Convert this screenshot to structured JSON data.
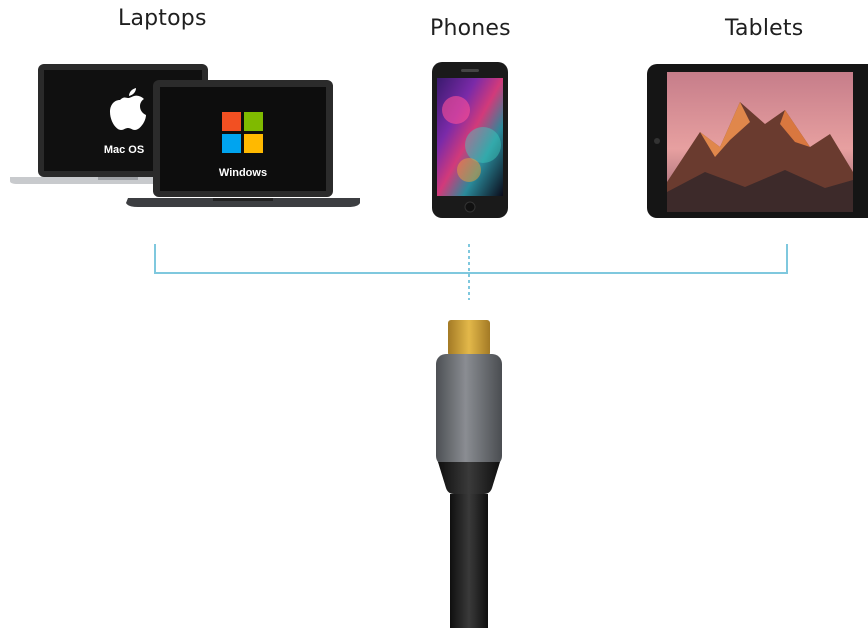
{
  "labels": {
    "laptops": "Laptops",
    "phones": "Phones",
    "tablets": "Tablets"
  },
  "laptop_macos_text": "Mac OS",
  "laptop_windows_text": "Windows",
  "colors": {
    "connector_line": "#7fc8de",
    "usb_tip_gold": "#d7a93a",
    "housing_gray": "#6f7277",
    "cable_black": "#1b1b1b",
    "ms_red": "#f25022",
    "ms_green": "#7fba00",
    "ms_blue": "#00a4ef",
    "ms_yellow": "#ffb900"
  }
}
